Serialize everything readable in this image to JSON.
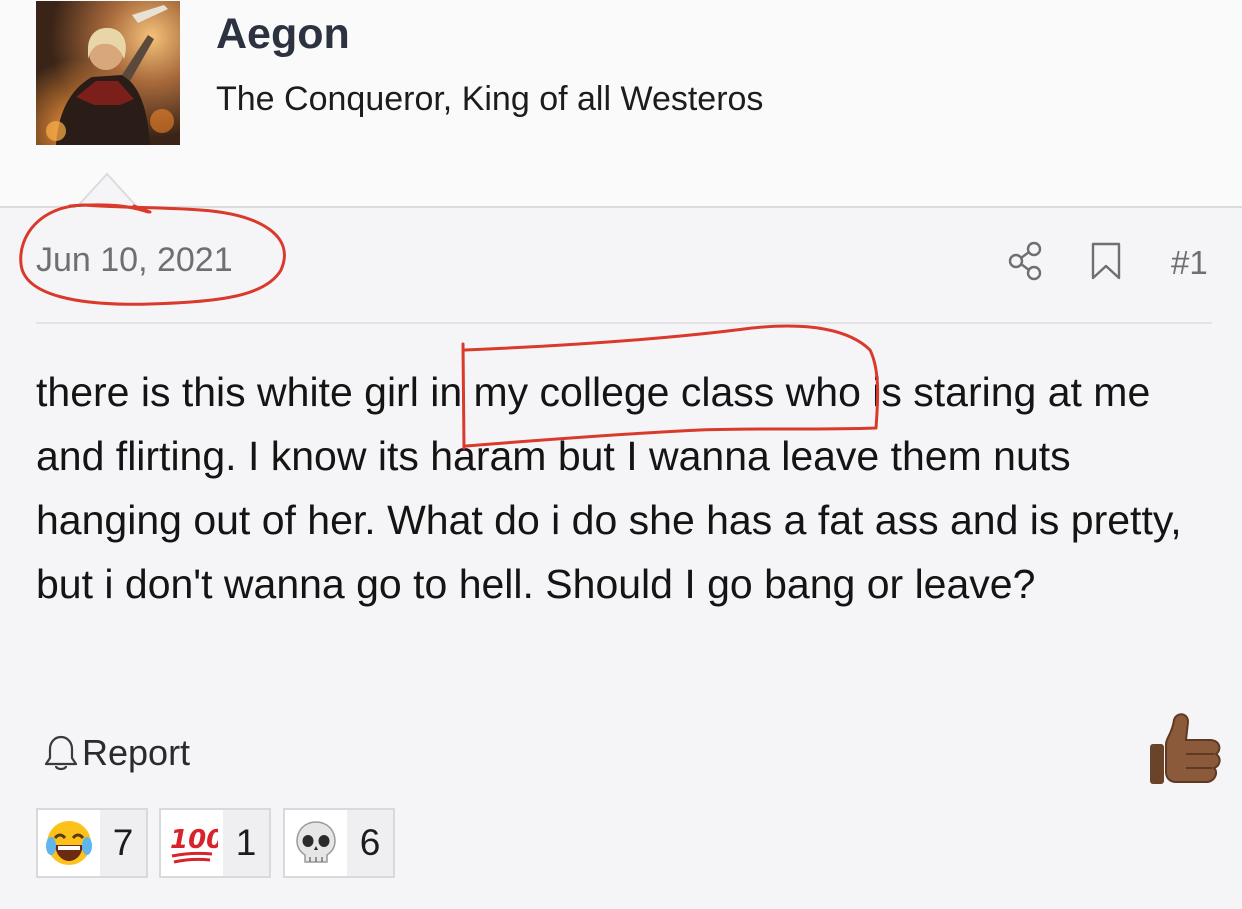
{
  "user": {
    "name": "Aegon",
    "title": "The Conqueror, King of all Westeros",
    "avatar_icon": "warrior-avatar-icon"
  },
  "post": {
    "date": "Jun 10, 2021",
    "number": "#1",
    "body": "there is this white girl in my college class who is staring at me and flirting. I know its haram but I wanna leave them nuts hanging out of her. What do i do she has a fat ass and is pretty, but i don't wanna go to hell. Should I go bang or leave?",
    "actions": {
      "share_icon": "share-icon",
      "bookmark_icon": "bookmark-icon",
      "report_label": "Report",
      "report_icon": "bell-icon",
      "like_icon": "thumbs-up-icon"
    }
  },
  "reactions": [
    {
      "emoji": "😂",
      "icon": "laughing-crying-emoji",
      "count": "7"
    },
    {
      "emoji": "💯",
      "icon": "hundred-points-emoji",
      "count": "1"
    },
    {
      "emoji": "💀",
      "icon": "skull-emoji",
      "count": "6"
    }
  ],
  "colors": {
    "annotation_red": "#d93a2b",
    "muted_text": "#6e6e73",
    "username": "#2d3240"
  }
}
